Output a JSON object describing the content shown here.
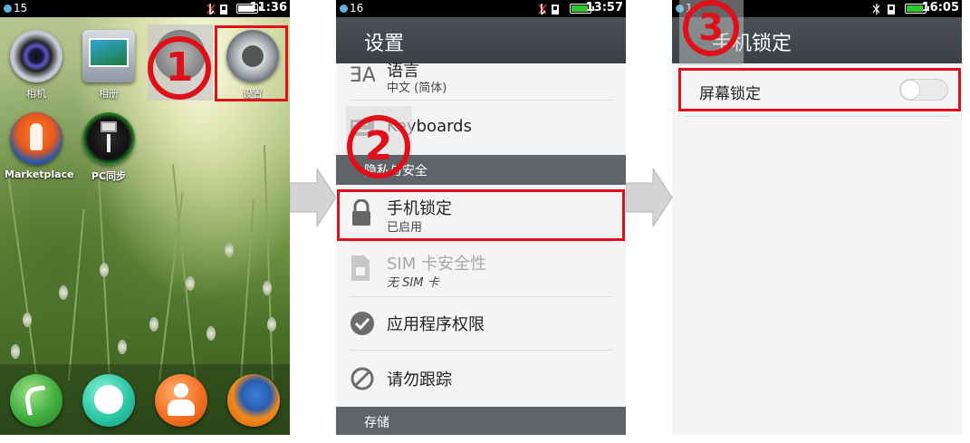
{
  "home": {
    "status": {
      "number": "15",
      "time": "11:36"
    },
    "apps": [
      {
        "label": "相机",
        "icon": "camera-icon"
      },
      {
        "label": "相册",
        "icon": "gallery-icon"
      },
      {
        "label": "设置",
        "icon": "settings-gear-icon"
      },
      {
        "label": "Marketplace",
        "icon": "marketplace-rocket-icon"
      },
      {
        "label": "PC同步",
        "icon": "usb-sync-icon"
      }
    ],
    "dock": [
      "phone-icon",
      "messages-icon",
      "contacts-icon",
      "firefox-icon"
    ],
    "step_number": "1"
  },
  "settings": {
    "status": {
      "number": "16",
      "time": "13:57"
    },
    "title": "设置",
    "language": {
      "title": "语言",
      "subtitle": "中文 (简体)"
    },
    "keyboards": {
      "title": "Keyboards"
    },
    "section_privacy": "隐私与安全",
    "phone_lock": {
      "title": "手机锁定",
      "subtitle": "已启用"
    },
    "sim_security": {
      "title": "SIM 卡安全性",
      "subtitle": "无 SIM 卡"
    },
    "app_permissions": {
      "title": "应用程序权限"
    },
    "do_not_track": {
      "title": "请勿跟踪"
    },
    "section_storage": "存储",
    "step_number": "2"
  },
  "lock": {
    "status": {
      "number": "1",
      "time": "16:05"
    },
    "title": "手机锁定",
    "screen_lock": {
      "label": "屏幕锁定",
      "enabled": false
    },
    "step_number": "3"
  },
  "colors": {
    "highlight": "#e0101a",
    "battery_green": "#2ec82e",
    "header": "#3e4449"
  }
}
